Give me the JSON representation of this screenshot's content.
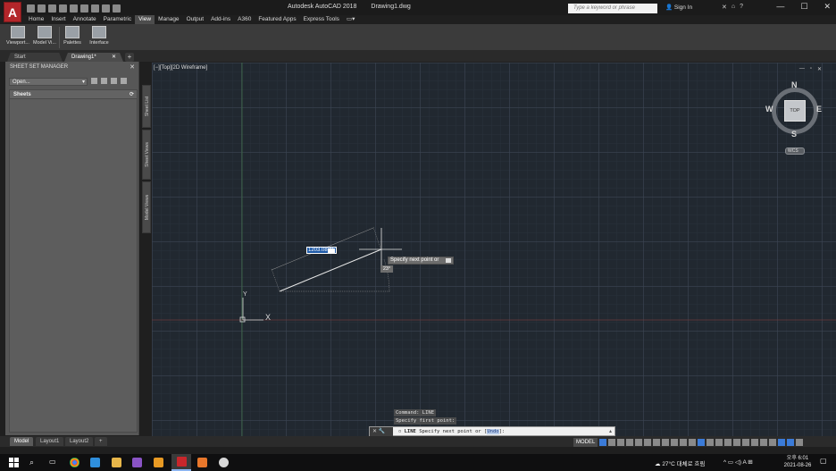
{
  "titlebar": {
    "app_letter": "A",
    "app_name": "Autodesk AutoCAD 2018",
    "doc_name": "Drawing1.dwg",
    "search_placeholder": "Type a keyword or phrase",
    "sign_in": "Sign In",
    "minimize": "—",
    "maximize": "☐",
    "close": "✕"
  },
  "ribbon_tabs": [
    "Home",
    "Insert",
    "Annotate",
    "Parametric",
    "View",
    "Manage",
    "Output",
    "Add-ins",
    "A360",
    "Featured Apps",
    "Express Tools"
  ],
  "ribbon_active_tab": "View",
  "ribbon_buttons": [
    "Viewport...",
    "Model Vi...",
    "Palettes",
    "Interface"
  ],
  "doc_tabs": [
    {
      "label": "Start"
    },
    {
      "label": "Drawing1*"
    }
  ],
  "sheet_set_manager": {
    "title": "SHEET SET MANAGER",
    "dropdown": "Open...",
    "list_header": "Sheets",
    "side_tabs": [
      "Sheet List",
      "Sheet Views",
      "Model Views"
    ]
  },
  "viewport": {
    "label": "[−][Top][2D Wireframe]",
    "controls": [
      "—",
      "▫",
      "✕"
    ]
  },
  "viewcube": {
    "face": "TOP",
    "north": "N",
    "south": "S",
    "east": "E",
    "west": "W",
    "wcs": "WCS"
  },
  "dynamic_input": {
    "length": "1203.0820",
    "prompt": "Specify next point or",
    "angle": "23°"
  },
  "ucs": {
    "y_label": "Y",
    "x_label": "X"
  },
  "command_history": [
    "Command: LINE",
    "Specify first point:"
  ],
  "command_line": {
    "command": "LINE",
    "prompt": "Specify next point or",
    "option": "Undo",
    "suffix": "]:"
  },
  "layout_tabs": [
    "Model",
    "Layout1",
    "Layout2"
  ],
  "status_model": "MODEL",
  "taskbar": {
    "weather": "27°C 대체로 흐림",
    "lang": "A",
    "time": "오후 6:01",
    "date": "2021-08-26"
  },
  "colors": {
    "app_red": "#b3262a",
    "canvas_bg": "#212830",
    "accent_blue": "#3b7bd8"
  }
}
